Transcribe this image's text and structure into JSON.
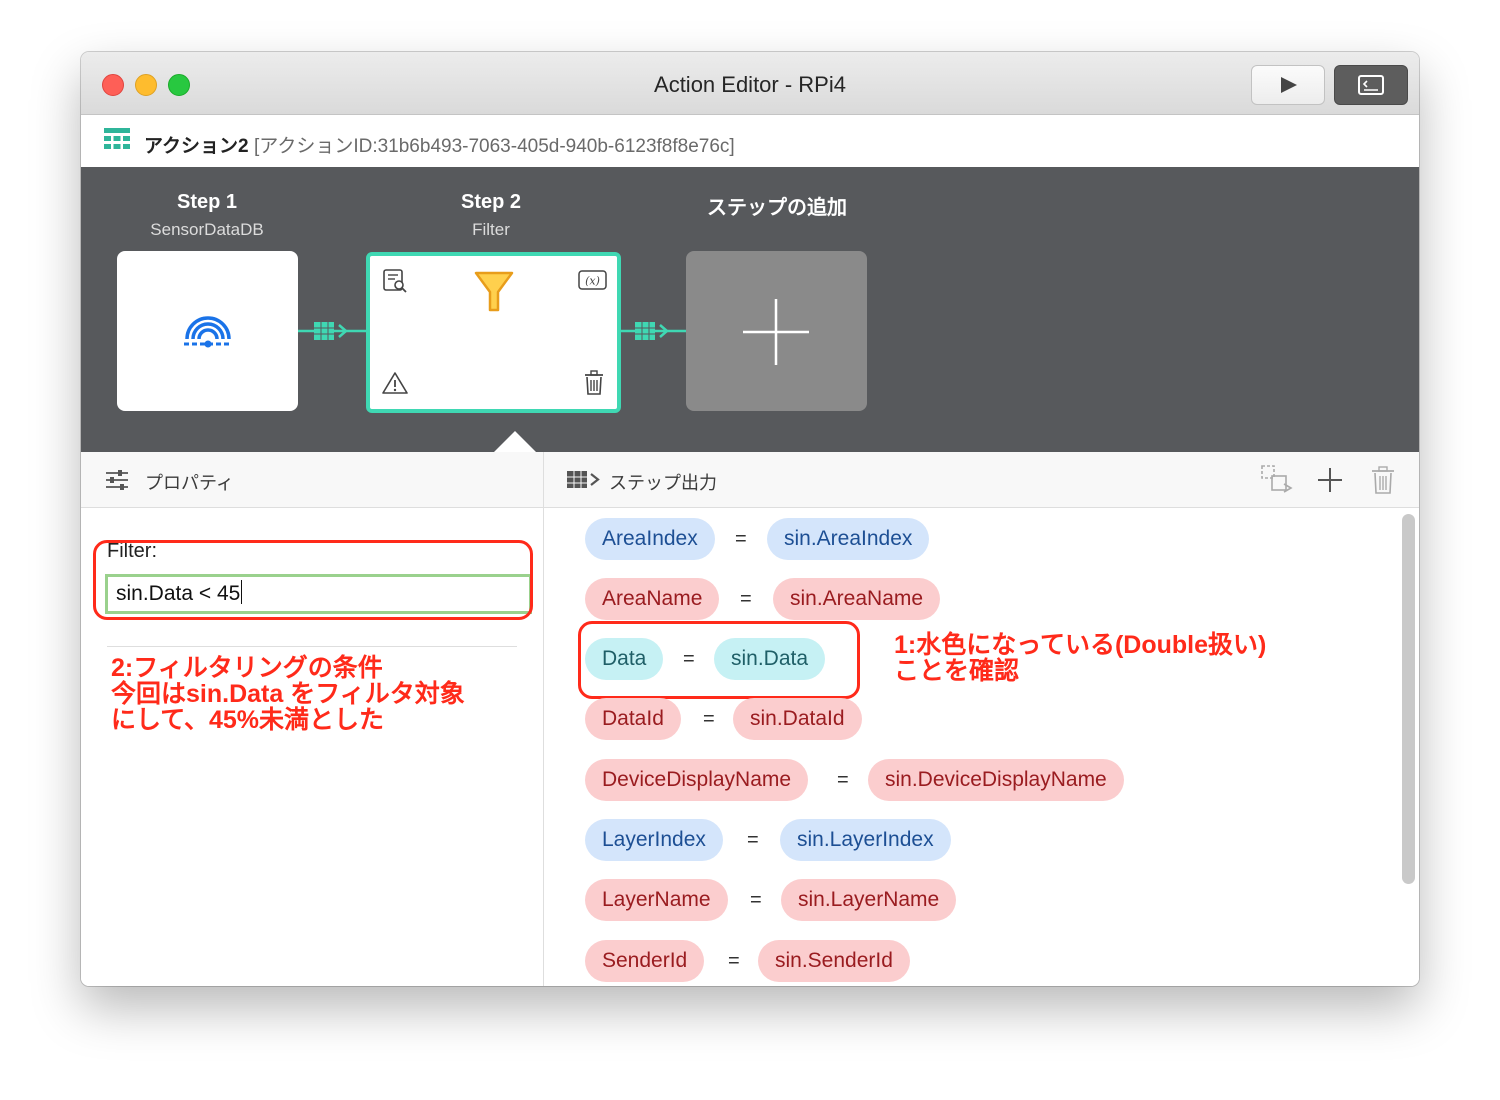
{
  "window": {
    "title": "Action Editor - RPi4"
  },
  "action": {
    "name": "アクション2",
    "id_text": "[アクションID:31b6b493-7063-405d-940b-6123f8f8e76c]"
  },
  "steps": [
    {
      "label": "Step 1",
      "sub": "SensorDataDB"
    },
    {
      "label": "Step 2",
      "sub": "Filter"
    },
    {
      "label": "ステップの追加",
      "sub": ""
    }
  ],
  "properties": {
    "title": "プロパティ",
    "filter_label": "Filter:",
    "filter_value": "sin.Data < 45"
  },
  "output": {
    "title": "ステップ出力",
    "mappings": [
      {
        "name": "AreaIndex",
        "source": "sin.AreaIndex",
        "color": "blue"
      },
      {
        "name": "AreaName",
        "source": "sin.AreaName",
        "color": "red"
      },
      {
        "name": "Data",
        "source": "sin.Data",
        "color": "cyan"
      },
      {
        "name": "DataId",
        "source": "sin.DataId",
        "color": "red"
      },
      {
        "name": "DeviceDisplayName",
        "source": "sin.DeviceDisplayName",
        "color": "red"
      },
      {
        "name": "LayerIndex",
        "source": "sin.LayerIndex",
        "color": "blue"
      },
      {
        "name": "LayerName",
        "source": "sin.LayerName",
        "color": "red"
      },
      {
        "name": "SenderId",
        "source": "sin.SenderId",
        "color": "red"
      }
    ],
    "equals": "="
  },
  "annotations": {
    "note1_line1": "1:水色になっている(Double扱い)",
    "note1_line2": "ことを確認",
    "note2_line1": "2:フィルタリングの条件",
    "note2_line2": "今回はsin.Data をフィルタ対象",
    "note2_line3": "にして、45%未満とした"
  },
  "colors": {
    "accent": "#3fd8b3",
    "annotation": "#ff2a1a",
    "canvas": "#57595c"
  },
  "icons": [
    "sensor-icon",
    "filter-icon",
    "search-list-icon",
    "variable-icon",
    "warning-icon",
    "trash-icon",
    "plus-icon",
    "sliders-icon",
    "output-icon",
    "play-icon",
    "terminal-icon"
  ]
}
